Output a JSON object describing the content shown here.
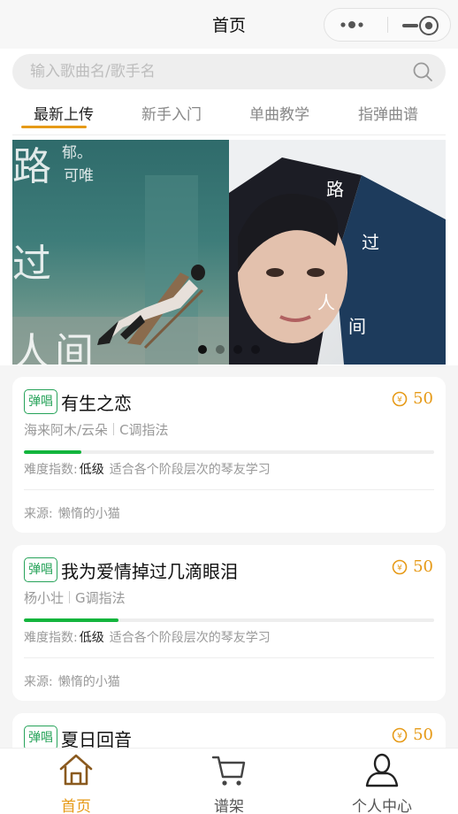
{
  "navbar": {
    "title": "首页"
  },
  "search": {
    "placeholder": "输入歌曲名/歌手名"
  },
  "tabs": [
    "最新上传",
    "新手入门",
    "单曲教学",
    "指弹曲谱"
  ],
  "banner": {
    "left_text": {
      "big": [
        "路",
        "过",
        "人",
        "间"
      ],
      "small": [
        "郁。",
        "可唯"
      ]
    },
    "right_text": {
      "chars": [
        "路",
        "过",
        "人",
        "间"
      ]
    },
    "slide_count": 4,
    "active_slide": 1
  },
  "songs": [
    {
      "badge": "弹唱",
      "title": "有生之恋",
      "price": "50",
      "artist": "海来阿木/云朵",
      "key": "C调指法",
      "difficulty_label": "难度指数:",
      "difficulty_level": "低级",
      "difficulty_desc": "适合各个阶段层次的琴友学习",
      "difficulty_fraction": 0.14,
      "source_label": "来源:",
      "source": "懒惰的小猫"
    },
    {
      "badge": "弹唱",
      "title": "我为爱情掉过几滴眼泪",
      "price": "50",
      "artist": "杨小壮",
      "key": "G调指法",
      "difficulty_label": "难度指数:",
      "difficulty_level": "低级",
      "difficulty_desc": "适合各个阶段层次的琴友学习",
      "difficulty_fraction": 0.23,
      "source_label": "来源:",
      "source": "懒惰的小猫"
    },
    {
      "badge": "弹唱",
      "title": "夏日回音",
      "price": "50"
    }
  ],
  "tabbar": [
    {
      "label": "首页",
      "icon": "home-icon",
      "active": true
    },
    {
      "label": "谱架",
      "icon": "cart-icon",
      "active": false
    },
    {
      "label": "个人中心",
      "icon": "user-icon",
      "active": false
    }
  ],
  "colors": {
    "accent": "#e69a17",
    "badge": "#27a35a",
    "progress": "#13b53d"
  }
}
